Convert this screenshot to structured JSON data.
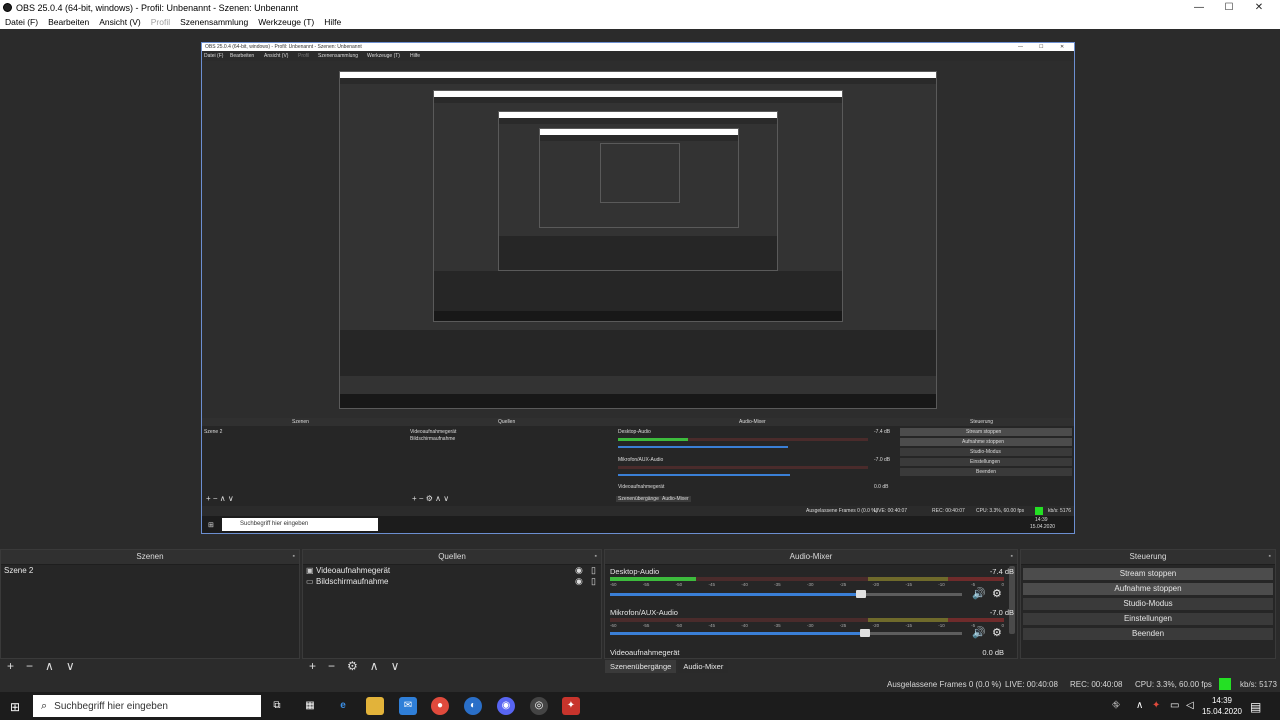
{
  "window": {
    "title": "OBS 25.0.4 (64-bit, windows) - Profil: Unbenannt - Szenen: Unbenannt",
    "controls": [
      "—",
      "☐",
      "✕"
    ]
  },
  "menu": {
    "file": "Datei (F)",
    "edit": "Bearbeiten",
    "view": "Ansicht (V)",
    "profile": "Profil",
    "scene_collection": "Szenensammlung",
    "tools": "Werkzeuge (T)",
    "help": "Hilfe"
  },
  "scenes": {
    "title": "Szenen",
    "items": [
      "Szene 2"
    ]
  },
  "sources": {
    "title": "Quellen",
    "items": [
      "Videoaufnahmegerät",
      "Bildschirmaufnahme"
    ]
  },
  "mixer": {
    "title": "Audio-Mixer",
    "channels": [
      {
        "name": "Desktop-Audio",
        "db": "-7.4 dB",
        "level": 0.22,
        "volume": 0.64
      },
      {
        "name": "Mikrofon/AUX-Audio",
        "db": "-7.0 dB",
        "level": 0.0,
        "volume": 0.65
      },
      {
        "name": "Videoaufnahmegerät",
        "db": "0.0 dB",
        "level": 0.0,
        "volume": 1.0
      }
    ],
    "ticks": [
      "-60",
      "-55",
      "-50",
      "-45",
      "-40",
      "-35",
      "-30",
      "-25",
      "-20",
      "-15",
      "-10",
      "-5",
      "0"
    ]
  },
  "tabs": {
    "transitions": "Szenenübergänge",
    "mixer": "Audio-Mixer"
  },
  "controls": {
    "title": "Steuerung",
    "stream": "Stream stoppen",
    "record": "Aufnahme stoppen",
    "studio": "Studio-Modus",
    "settings": "Einstellungen",
    "exit": "Beenden"
  },
  "status": {
    "dropped": "Ausgelassene Frames 0 (0.0 %)",
    "live": "LIVE: 00:40:08",
    "rec": "REC: 00:40:08",
    "cpu": "CPU: 3.3%, 60.00 fps",
    "kbs": "kb/s: 5173"
  },
  "preview_inner": {
    "title": "OBS 25.0.4 (64-bit, windows) - Profil: Unbenannt - Szenen: Unbenannt",
    "menu": [
      "Datei (F)",
      "Bearbeiten",
      "Ansicht (V)",
      "Profil",
      "Szenensammlung",
      "Werkzeuge (T)",
      "Hilfe"
    ],
    "scenes": "Szenen",
    "sources": "Quellen",
    "mixer": "Audio-Mixer",
    "controls": "Steuerung",
    "scene_item": "Szene 2",
    "source_items": [
      "Videoaufnahmegerät",
      "Bildschirmaufnahme"
    ],
    "desktop": "Desktop-Audio",
    "desktop_db": "-7.4 dB",
    "mic": "Mikrofon/AUX-Audio",
    "mic_db": "-7.0 dB",
    "video": "Videoaufnahmegerät",
    "video_db": "0.0 dB",
    "ctl": [
      "Stream stoppen",
      "Aufnahme stoppen",
      "Studio-Modus",
      "Einstellungen",
      "Beenden"
    ],
    "tab1": "Szenenübergänge",
    "tab2": "Audio-Mixer",
    "status_dropped": "Ausgelassene Frames 0 (0.0 %)",
    "status_live": "LIVE: 00:40:07",
    "status_rec": "REC: 00:40:07",
    "status_cpu": "CPU: 3.3%, 60.00 fps",
    "status_kbs": "kb/s: 5176",
    "search": "Suchbegriff hier eingeben",
    "time": "14:39",
    "date": "15.04.2020"
  },
  "taskbar": {
    "search_placeholder": "Suchbegriff hier eingeben",
    "time": "14:39",
    "date": "15.04.2020"
  },
  "colors": {
    "accent_blue": "#3a7fd6",
    "meter_green": "#3dbb3d",
    "status_green": "#24e024"
  }
}
